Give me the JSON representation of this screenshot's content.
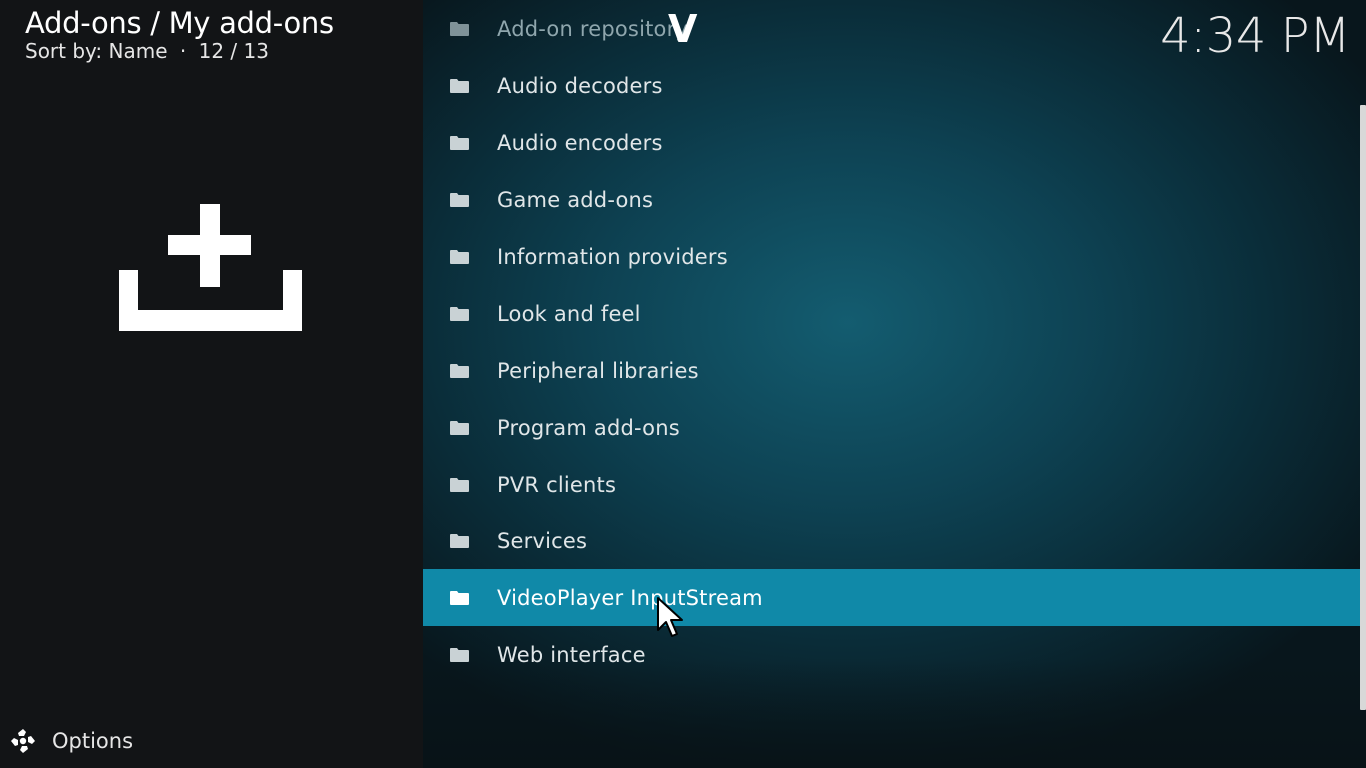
{
  "header": {
    "breadcrumb": "Add-ons / My add-ons",
    "sort_label": "Sort by: Name",
    "separator": "·",
    "position": "12 / 13"
  },
  "clock": "4:34 PM",
  "hero_icon": "addon-install-icon",
  "footer": {
    "options_label": "Options",
    "options_icon": "options-gear-icon"
  },
  "list": {
    "items": [
      {
        "label": "Add-on repository",
        "icon": "folder-icon",
        "state": "dim"
      },
      {
        "label": "Audio decoders",
        "icon": "folder-icon",
        "state": "normal"
      },
      {
        "label": "Audio encoders",
        "icon": "folder-icon",
        "state": "normal"
      },
      {
        "label": "Game add-ons",
        "icon": "folder-icon",
        "state": "normal"
      },
      {
        "label": "Information providers",
        "icon": "folder-icon",
        "state": "normal"
      },
      {
        "label": "Look and feel",
        "icon": "folder-icon",
        "state": "normal"
      },
      {
        "label": "Peripheral libraries",
        "icon": "folder-icon",
        "state": "normal"
      },
      {
        "label": "Program add-ons",
        "icon": "folder-icon",
        "state": "normal"
      },
      {
        "label": "PVR clients",
        "icon": "folder-icon",
        "state": "normal"
      },
      {
        "label": "Services",
        "icon": "folder-icon",
        "state": "normal"
      },
      {
        "label": "VideoPlayer InputStream",
        "icon": "folder-icon",
        "state": "selected"
      },
      {
        "label": "Web interface",
        "icon": "folder-icon",
        "state": "normal"
      }
    ],
    "scroll_marker": "V"
  },
  "colors": {
    "selected_row": "#1089a8",
    "left_panel": "#121416",
    "text": "#ffffff"
  }
}
